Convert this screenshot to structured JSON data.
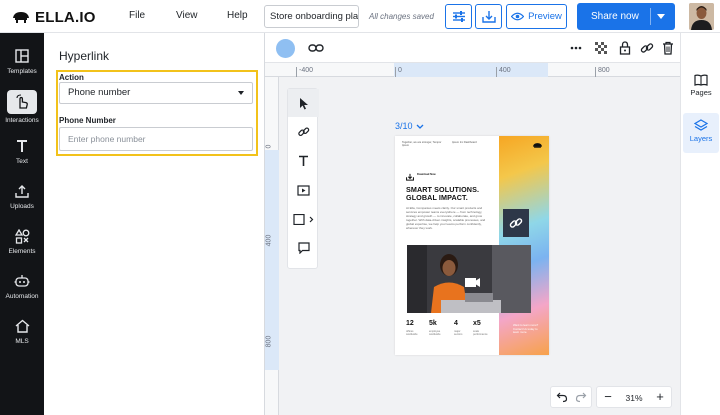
{
  "header": {
    "brand": "ELLA.IO",
    "menu": [
      "File",
      "View",
      "Help"
    ],
    "document_name": "Store onboarding pla...",
    "save_status": "All changes saved",
    "preview_label": "Preview",
    "share_label": "Share now",
    "accent_color": "#1a73e8"
  },
  "sidebar": {
    "items": [
      {
        "label": "Templates",
        "icon": "templates-icon"
      },
      {
        "label": "Interactions",
        "icon": "pointer-hand-icon",
        "active": true
      },
      {
        "label": "Text",
        "icon": "text-icon"
      },
      {
        "label": "Uploads",
        "icon": "upload-icon"
      },
      {
        "label": "Elements",
        "icon": "shapes-icon"
      },
      {
        "label": "Automation",
        "icon": "robot-icon"
      },
      {
        "label": "MLS",
        "icon": "house-icon"
      }
    ]
  },
  "panel": {
    "title": "Hyperlink",
    "action_label": "Action",
    "action_value": "Phone number",
    "phone_label": "Phone Number",
    "phone_placeholder": "Enter phone number",
    "focus_color": "#f2c21b"
  },
  "canvas": {
    "rulers": {
      "top": [
        "-400",
        "0",
        "400",
        "800"
      ],
      "left": [
        "0",
        "400",
        "800"
      ]
    },
    "page_indicator": "3/10",
    "zoom": "31%",
    "tools": [
      "cursor-icon",
      "link-icon",
      "text-icon",
      "video-icon",
      "shape-icon",
      "comment-icon"
    ]
  },
  "artboard": {
    "header_left": "Together, we are stronger, Tempor Ipsum",
    "header_right": "Ipsum Inc Dashboard",
    "download_label": "Download Now",
    "headline_1": "SMART SOLUTIONS.",
    "headline_2": "GLOBAL IMPACT.",
    "body": "At Ella, Companies meets clarity. Our smart products and services empower teams everywhere — from technology, strategy and growth — to innovate, collaborate, and grow together. With data-driven insights, scalable processes, and global expertise, we help your teams perform confidently, wherever they work.",
    "stats": [
      {
        "value": "12",
        "label": "offices worldwide"
      },
      {
        "value": "5k",
        "label": "employee worldwide"
      },
      {
        "value": "4",
        "label": "major sectors"
      },
      {
        "value": "x5",
        "label": "scale performance"
      }
    ],
    "cta_text": "Want to learn more? Contact Us today to learn more."
  },
  "right_rail": {
    "items": [
      {
        "label": "Pages",
        "icon": "pages-icon"
      },
      {
        "label": "Layers",
        "icon": "layers-icon",
        "active": true
      }
    ]
  }
}
